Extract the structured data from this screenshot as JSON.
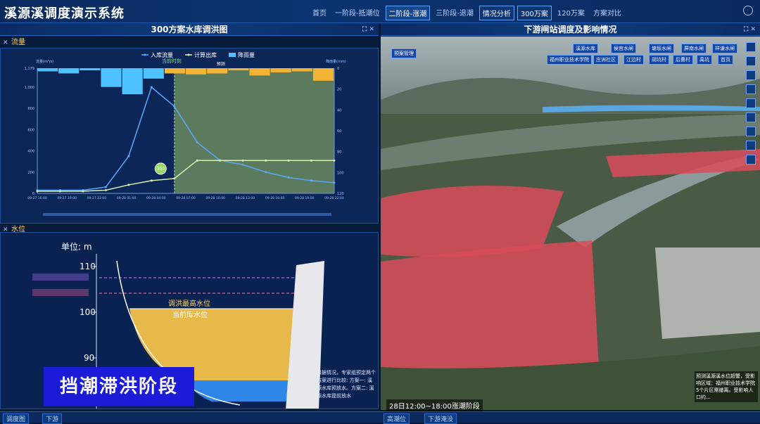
{
  "app": {
    "title": "溪源溪调度演示系统"
  },
  "nav": {
    "items": [
      {
        "label": "首页",
        "style": "plain"
      },
      {
        "label": "一阶段-抵潮位",
        "style": "plain"
      },
      {
        "label": "二阶段-涨潮",
        "style": "active"
      },
      {
        "label": "三阶段-退潮",
        "style": "plain"
      },
      {
        "label": "情况分析",
        "style": "boxed"
      },
      {
        "label": "300万案",
        "style": "boxed"
      },
      {
        "label": "120万案",
        "style": "plain"
      },
      {
        "label": "方案对比",
        "style": "plain"
      }
    ]
  },
  "left_panel": {
    "title": "300方案水库调洪图",
    "flow": {
      "subtitle": "流量",
      "legend": [
        "入库流量",
        "计算出库",
        "降雨量"
      ],
      "current_label": "当前时刻",
      "forecast_label": "预测",
      "marker_label": "300",
      "y_left_unit": "流量(m³/s)",
      "y_right_unit": "降雨量(mm)"
    },
    "water": {
      "subtitle": "水位",
      "unit": "单位: m",
      "ticks": [
        "110",
        "100",
        "90"
      ],
      "max_level_label": "调洪最高水位",
      "current_level_label": "当前库水位",
      "notes": "根据情况，专家组预定两个方案进行比较: 方案一: 溪源水库预放水。方案二: 溪源水库提前放水"
    },
    "banner": "挡潮滞洪阶段"
  },
  "right_panel": {
    "title": "下游闸站调度及影响情况",
    "top_label": "预案管理",
    "buttons_row1": [
      "溪源水库",
      "侯官水闸",
      "塘坂水闸",
      "屏南水闸",
      "祥谦水闸"
    ],
    "buttons_row2": [
      "福州职业技术学院",
      "庄洲社区",
      "江边村",
      "胡坑村",
      "后曹村",
      "禹坑",
      "首页"
    ],
    "time_label": "28日12:00~18:00涨潮阶段",
    "note": "预测溪源溪水位超警，受影响区域：福州职业技术学院5个片区需撤离。受影响人口约…"
  },
  "bottom": {
    "left_tab": "调度图",
    "left_tab2": "下游",
    "right_tab": "高潮位",
    "right_tab2": "下游淹没"
  },
  "chart_data": {
    "type": "line",
    "title": "",
    "x": [
      "09-27 16:00",
      "09-27 19:00",
      "09-27 22:00",
      "09-28 01:00",
      "09-28 04:00",
      "09-28 07:00",
      "09-28 10:00",
      "09-28 13:00",
      "09-28 16:00",
      "09-28 19:00",
      "09-28 22:00"
    ],
    "ylim": [
      0,
      1179
    ],
    "y_ticks": [
      0,
      200,
      400,
      600,
      800,
      1000,
      1179
    ],
    "y2_ticks": [
      0,
      20,
      40,
      60,
      80,
      100,
      120
    ],
    "series": [
      {
        "name": "入库流量",
        "values": [
          30,
          30,
          30,
          60,
          350,
          1000,
          820,
          480,
          310,
          270,
          200,
          150,
          120,
          100
        ]
      },
      {
        "name": "计算出库",
        "values": [
          20,
          20,
          20,
          30,
          80,
          120,
          140,
          310,
          310,
          310,
          310,
          310,
          310,
          310
        ]
      },
      {
        "name": "降雨量",
        "values": [
          3,
          5,
          2,
          18,
          25,
          10,
          5,
          6,
          5,
          2,
          7,
          4,
          3,
          12
        ]
      }
    ],
    "current_index": 6
  }
}
